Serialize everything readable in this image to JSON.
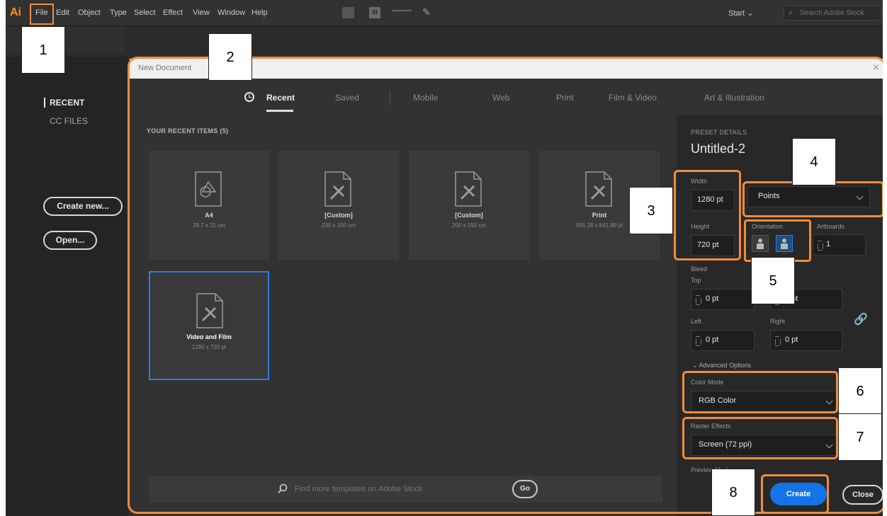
{
  "menubar": {
    "logo": "Ai",
    "items": [
      "File",
      "Edit",
      "Object",
      "Type",
      "Select",
      "Effect",
      "View",
      "Window",
      "Help"
    ],
    "st_icon": "St",
    "workspace": "Start",
    "search_placeholder": "Search Adobe Stock"
  },
  "left_nav": {
    "recent": "RECENT",
    "cc_files": "CC FILES",
    "create_new": "Create new...",
    "open": "Open..."
  },
  "dialog": {
    "title": "New Document",
    "close": "×",
    "tabs": [
      "Recent",
      "Saved",
      "Mobile",
      "Web",
      "Print",
      "Film & Video",
      "Art & Illustration"
    ],
    "recent_heading": "YOUR RECENT ITEMS",
    "recent_count": "(5)",
    "items": [
      {
        "name": "A4",
        "size": "29.7 x 21 cm"
      },
      {
        "name": "[Custom]",
        "size": "230 x 150 cm"
      },
      {
        "name": "[Custom]",
        "size": "200 x 150 cm"
      },
      {
        "name": "Print",
        "size": "595.28 x 841.89 pt"
      },
      {
        "name": "Video and Film",
        "size": "1280 x 720 pt"
      }
    ],
    "stock_placeholder": "Find more templates on Adobe Stock",
    "go": "Go"
  },
  "preset": {
    "heading": "PRESET DETAILS",
    "name": "Untitled-2",
    "width_label": "Width",
    "width": "1280 pt",
    "units": "Points",
    "height_label": "Height",
    "height": "720 pt",
    "orientation_label": "Orientation",
    "artboards_label": "Artboards",
    "artboards": "1",
    "bleed_label": "Bleed",
    "top_label": "Top",
    "top": "0 pt",
    "bottom": "0 pt",
    "left_label": "Left",
    "left": "0 pt",
    "right_label": "Right",
    "right": "0 pt",
    "advanced": "Advanced Options",
    "color_mode_label": "Color Mode",
    "color_mode": "RGB Color",
    "raster_label": "Raster Effects",
    "raster": "Screen (72 ppi)",
    "preview_label": "Preview Mode",
    "create": "Create",
    "close": "Close"
  },
  "annotations": [
    "1",
    "2",
    "3",
    "4",
    "5",
    "6",
    "7",
    "8"
  ],
  "colors": {
    "annotation": "#f08c3c",
    "accent": "#1473e6",
    "selection": "#2680eb"
  }
}
